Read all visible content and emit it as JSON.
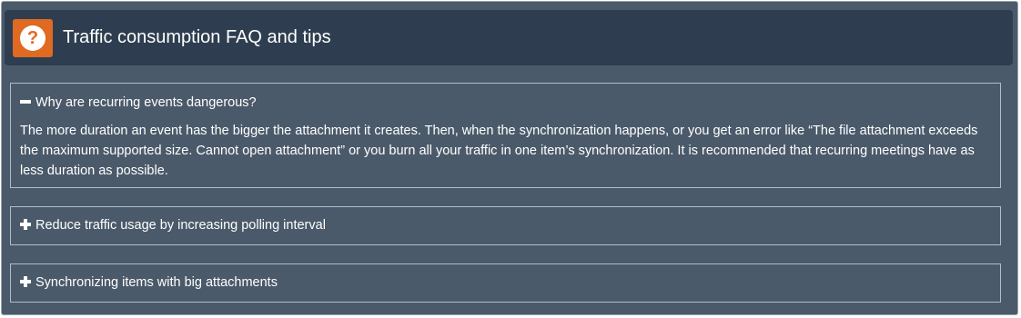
{
  "header": {
    "icon": "question-circle-icon",
    "icon_glyph": "?",
    "accent_color": "#e06a22",
    "title": "Traffic consumption FAQ and tips"
  },
  "faq": [
    {
      "question": "Why are recurring events dangerous?",
      "expanded": true,
      "toggle_icon": "minus-icon",
      "answer": "The more duration an event has the bigger the attachment it creates. Then, when the synchronization happens, or you get an error like “The file attachment exceeds the maximum supported size. Cannot open attachment” or you burn all your traffic in one item’s synchronization. It is recommended that recurring meetings have as less duration as possible."
    },
    {
      "question": "Reduce traffic usage by increasing polling interval",
      "expanded": false,
      "toggle_icon": "plus-icon"
    },
    {
      "question": "Synchronizing items with big attachments",
      "expanded": false,
      "toggle_icon": "plus-icon"
    }
  ]
}
